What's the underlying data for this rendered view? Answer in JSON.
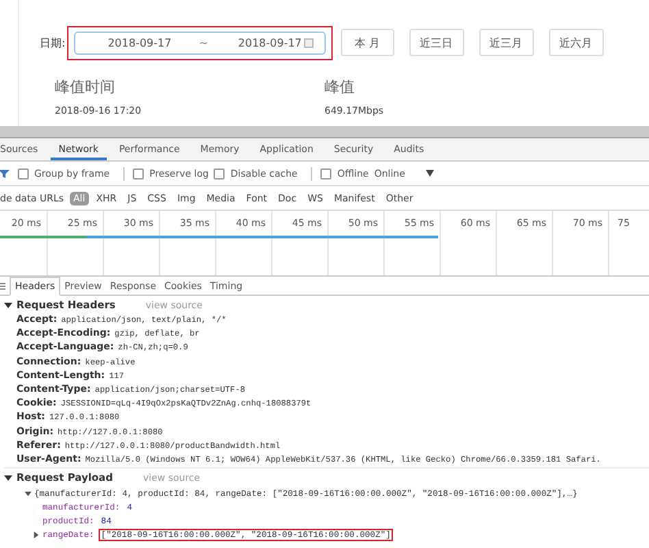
{
  "page": {
    "date_label": "日期:",
    "date_range": {
      "start": "2018-09-17",
      "separator": "~",
      "end": "2018-09-17",
      "highlighted": true
    },
    "quick_buttons": [
      "本 月",
      "近三日",
      "近三月",
      "近六月"
    ],
    "table": {
      "columns": [
        "峰值时间",
        "峰值"
      ],
      "rows": [
        [
          "2018-09-16 17:20",
          "649.17Mbps"
        ]
      ]
    }
  },
  "devtools": {
    "tabs": [
      {
        "label": "Sources",
        "selected": false
      },
      {
        "label": "Network",
        "selected": true
      },
      {
        "label": "Performance",
        "selected": false
      },
      {
        "label": "Memory",
        "selected": false
      },
      {
        "label": "Application",
        "selected": false
      },
      {
        "label": "Security",
        "selected": false
      },
      {
        "label": "Audits",
        "selected": false
      }
    ],
    "toolbar": [
      {
        "kind": "checkbox",
        "label": "Group by frame",
        "checked": false
      },
      {
        "kind": "divider"
      },
      {
        "kind": "checkbox",
        "label": "Preserve log",
        "checked": false
      },
      {
        "kind": "checkbox",
        "label": "Disable cache",
        "checked": false
      },
      {
        "kind": "divider"
      },
      {
        "kind": "checkbox",
        "label": "Offline",
        "checked": false
      },
      {
        "kind": "dropdown",
        "label": "Online"
      }
    ],
    "filter": {
      "partial_label": "de data URLs",
      "types": [
        {
          "label": "All",
          "selected": true
        },
        {
          "label": "XHR",
          "selected": false
        },
        {
          "label": "JS",
          "selected": false
        },
        {
          "label": "CSS",
          "selected": false
        },
        {
          "label": "Img",
          "selected": false
        },
        {
          "label": "Media",
          "selected": false
        },
        {
          "label": "Font",
          "selected": false
        },
        {
          "label": "Doc",
          "selected": false
        },
        {
          "label": "WS",
          "selected": false
        },
        {
          "label": "Manifest",
          "selected": false
        },
        {
          "label": "Other",
          "selected": false
        }
      ]
    },
    "timeline": {
      "ticks": [
        "20 ms",
        "25 ms",
        "30 ms",
        "35 ms",
        "40 ms",
        "45 ms",
        "50 ms",
        "55 ms",
        "60 ms",
        "65 ms",
        "70 ms",
        "75"
      ]
    },
    "detail_tabs": [
      {
        "label": "Headers",
        "selected": true
      },
      {
        "label": "Preview",
        "selected": false
      },
      {
        "label": "Response",
        "selected": false
      },
      {
        "label": "Cookies",
        "selected": false
      },
      {
        "label": "Timing",
        "selected": false
      }
    ],
    "request_headers": {
      "title": "Request Headers",
      "link": "view source",
      "expanded": true,
      "rows": [
        {
          "name": "Accept:",
          "value": "application/json, text/plain, */*"
        },
        {
          "name": "Accept-Encoding:",
          "value": "gzip, deflate, br"
        },
        {
          "name": "Accept-Language:",
          "value": "zh-CN,zh;q=0.9"
        },
        {
          "name": "Connection:",
          "value": "keep-alive"
        },
        {
          "name": "Content-Length:",
          "value": "117"
        },
        {
          "name": "Content-Type:",
          "value": "application/json;charset=UTF-8"
        },
        {
          "name": "Cookie:",
          "value": "JSESSIONID=qLq-4I9qOx2psKaQTDv2ZnAg.cnhq-18088379t"
        },
        {
          "name": "Host:",
          "value": "127.0.0.1:8080"
        },
        {
          "name": "Origin:",
          "value": "http://127.0.0.1:8080"
        },
        {
          "name": "Referer:",
          "value": "http://127.0.0.1:8080/productBandwidth.html"
        },
        {
          "name": "User-Agent:",
          "value": "Mozilla/5.0 (Windows NT 6.1; WOW64) AppleWebKit/537.36 (KHTML, like Gecko) Chrome/66.0.3359.181 Safari."
        }
      ]
    },
    "request_payload": {
      "title": "Request Payload",
      "link": "view source",
      "expanded": true,
      "summary": {
        "text": "{manufacturerId: 4, productId: 84, rangeDate: [\"2018-09-16T16:00:00.000Z\", \"2018-09-16T16:00:00.000Z\"],…}",
        "expanded": true
      },
      "fields": [
        {
          "name": "manufacturerId:",
          "value": "4",
          "expandable": false,
          "highlighted": false
        },
        {
          "name": "productId:",
          "value": "84",
          "expandable": false,
          "highlighted": false
        },
        {
          "name": "rangeDate:",
          "value": "[\"2018-09-16T16:00:00.000Z\", \"2018-09-16T16:00:00.000Z\"]",
          "expandable": true,
          "highlighted": true
        }
      ]
    }
  }
}
